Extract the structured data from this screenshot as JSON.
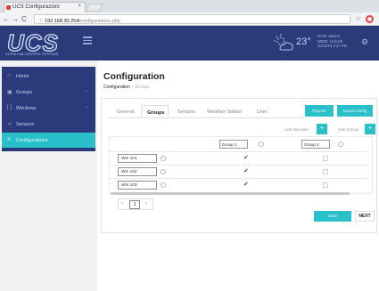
{
  "browser": {
    "tab_title": "UCS Configurazioni",
    "tab_close": "×",
    "back": "←",
    "forward": "→",
    "reload": "C",
    "info": "ⓘ",
    "url_host": "192.168.30.254/",
    "url_path": "configurations.php",
    "star": "☆"
  },
  "header": {
    "logo_text": "UCS",
    "logo_subtitle": "ULTRA LAB CONTROL SYSTEMS",
    "temperature": "23°",
    "weather_lines": [
      "RAIN: absent",
      "WIND: 10 km/h",
      "10/10/16 2:47 PM"
    ],
    "gear": "⚙"
  },
  "sidebar": {
    "items": [
      {
        "label": "Home",
        "icon": "⌂",
        "arrow": ""
      },
      {
        "label": "Groups",
        "icon": "▣",
        "arrow": "›"
      },
      {
        "label": "Windows",
        "icon": "[ ]",
        "arrow": "›"
      },
      {
        "label": "Sensors",
        "icon": "≺",
        "arrow": ""
      },
      {
        "label": "Configurations",
        "icon": "≡",
        "arrow": ""
      }
    ]
  },
  "page": {
    "title": "Configuration",
    "breadcrumb_root": "Configuration",
    "breadcrumb_sep": "›",
    "breadcrumb_current": "Groups"
  },
  "tabs": [
    "General",
    "Groups",
    "Sensors",
    "Weather Station",
    "User"
  ],
  "actions": {
    "btn1": "Reports",
    "btn2": "Export config",
    "add_window": "Add Window",
    "add_group": "Add Group",
    "plus": "+"
  },
  "table": {
    "group_headers": [
      "Group 1",
      "Group 2"
    ],
    "rows": [
      {
        "window": "Win 101",
        "group1": true,
        "group2": false
      },
      {
        "window": "Win 102",
        "group1": true,
        "group2": false
      },
      {
        "window": "Win 103",
        "group1": true,
        "group2": false
      }
    ],
    "check_mark": "✔"
  },
  "pager": {
    "prev": "‹",
    "page": "1",
    "next": "›"
  },
  "footer": {
    "save": "Save",
    "next": "NEXT"
  },
  "colors": {
    "header_bg": "#2a3b79",
    "accent": "#29c0c9"
  }
}
